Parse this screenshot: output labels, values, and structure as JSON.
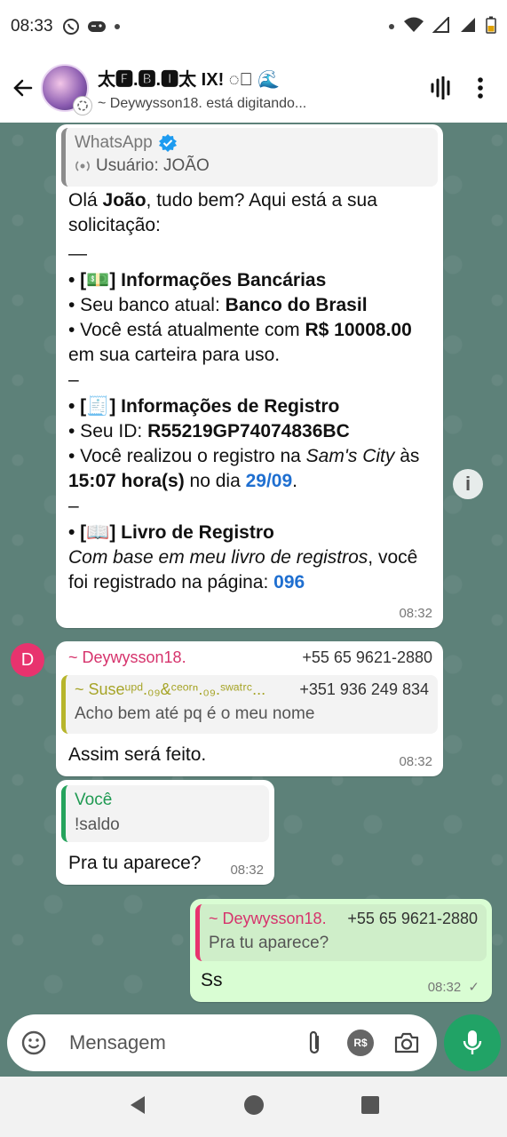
{
  "status_bar": {
    "time": "08:33"
  },
  "header": {
    "title": "太🅵.🅱.🅸太 IX! ◌⃝ 🌊",
    "subtitle": "~ Deywysson18. está digitando..."
  },
  "messages": {
    "m1": {
      "quote_name": "WhatsApp",
      "quote_text": "Usuário: JOÃO",
      "greet_pre": "Olá ",
      "greet_name": "João",
      "greet_post": ", tudo bem? Aqui está a sua solicitação:",
      "sep1": "—",
      "bank_head": "• [💵] Informações Bancárias",
      "bank_line1_pre": "• Seu banco atual: ",
      "bank_line1_val": "Banco do Brasil",
      "bank_line2_pre": "• Você está atualmente com ",
      "bank_line2_val": "R$ 10008.00",
      "bank_line2_post": " em sua carteira para uso.",
      "sep2": "–",
      "reg_head": "• [🧾] Informações de Registro",
      "reg_line1_pre": "• Seu ID: ",
      "reg_line1_val": "R55219GP74074836BC",
      "reg_line2_pre": "• Você realizou o registro na ",
      "reg_line2_city": "Sam's City",
      "reg_line2_mid": " às ",
      "reg_line2_time": "15:07 hora(s)",
      "reg_line2_mid2": " no dia ",
      "reg_line2_date": "29/09",
      "reg_line2_end": ".",
      "sep3": "–",
      "book_head": "• [📖] Livro de Registro",
      "book_line_italic": "Com base em meu livro de registros",
      "book_line_post": ", você foi registrado na página: ",
      "book_page": "096",
      "time": "08:32"
    },
    "m2": {
      "avatar_letter": "D",
      "sender": "~ Deywysson18.",
      "sender_phone": "+55 65 9621-2880",
      "quote_name": "~ Suseᵘᵖᵈ.₀₉&ᶜᵉᵒʳⁿ.₀₉.ˢʷᵃᵗʳᶜ...",
      "quote_phone": "+351 936 249 834",
      "quote_text": "Acho bem até pq é o meu nome",
      "text": "Assim será feito.",
      "time": "08:32"
    },
    "m3": {
      "quote_name": "Você",
      "quote_text": "!saldo",
      "text": "Pra tu aparece?",
      "time": "08:32"
    },
    "m4": {
      "quote_name": "~ Deywysson18.",
      "quote_phone": "+55 65 9621-2880",
      "quote_text": "Pra tu aparece?",
      "text": "Ss",
      "time": "08:32",
      "check": "✓"
    }
  },
  "composer": {
    "placeholder": "Mensagem",
    "currency_label": "R$"
  },
  "colors": {
    "accent_green": "#21a366",
    "chat_bg": "#5d8179",
    "outgoing": "#d9fdd3",
    "link_blue": "#1f6fd0",
    "sender_pink": "#d6336c"
  }
}
